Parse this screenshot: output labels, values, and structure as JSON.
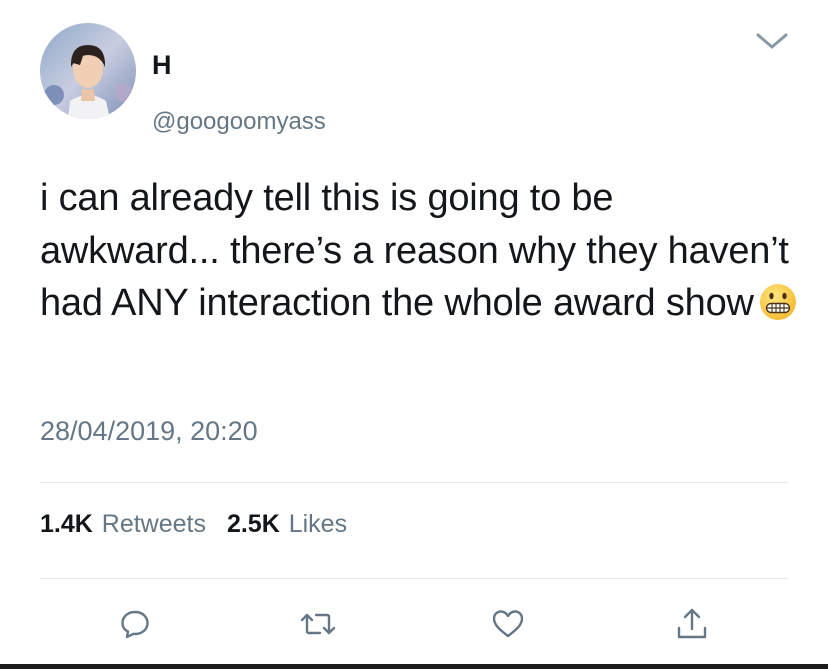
{
  "tweet": {
    "author": {
      "display_name": "H",
      "handle": "@googoomyass",
      "avatar_icon": "profile-photo"
    },
    "text": "i can already tell this is going to be awkward... there’s a reason why they haven’t had ANY interaction the whole award show",
    "emoji": "grimacing-face",
    "timestamp": "28/04/2019, 20:20",
    "stats": {
      "retweets_count": "1.4K",
      "retweets_label": "Retweets",
      "likes_count": "2.5K",
      "likes_label": "Likes"
    },
    "actions": {
      "reply_icon": "reply-icon",
      "retweet_icon": "retweet-icon",
      "like_icon": "heart-icon",
      "share_icon": "share-icon"
    },
    "menu_icon": "chevron-down-icon"
  },
  "colors": {
    "primary_text": "#14171a",
    "secondary_text": "#657786",
    "divider": "#e1e8ed",
    "action_icon": "#657786"
  }
}
